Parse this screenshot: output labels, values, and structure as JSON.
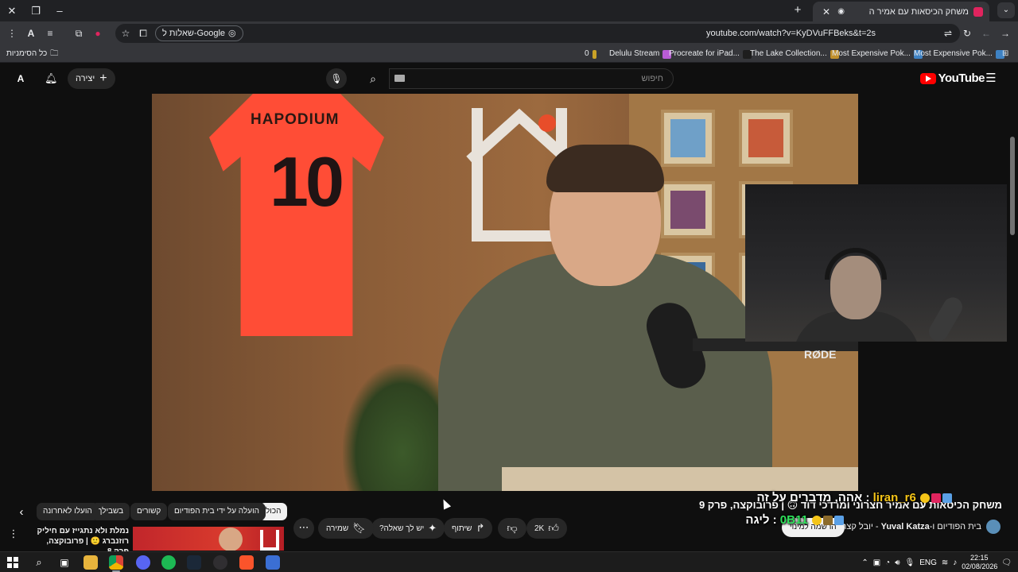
{
  "browser": {
    "tab_title": "משחק הכיסאות עם אמיר ה",
    "url": "youtube.com/watch?v=KyDVuFFBeks&t=2s",
    "google_ask_label": "שאלות ל-Google",
    "bookmarks": [
      {
        "label": "Delulu Stream",
        "color": "#b95cd6"
      },
      {
        "label": "Procreate for iPad...",
        "color": "#1e1e1e"
      },
      {
        "label": "The Lake Collection...",
        "color": "#c08f2b"
      },
      {
        "label": "Most Expensive Pok...",
        "color": "#3e82c4"
      },
      {
        "label": "Most Expensive Pok...",
        "color": "#3e82c4"
      }
    ],
    "bookmark_count": "0",
    "all_bookmarks_label": "כל הסימניות"
  },
  "youtube": {
    "logo_text": "YouTube",
    "search_placeholder": "חיפוש",
    "create_label": "יצירה",
    "avatar_letter": "A"
  },
  "video": {
    "jersey_name": "HAPODIUM",
    "jersey_number": "10",
    "mic_brand": "RØDE",
    "title": "משחק הכיסאות עם אמיר חצרוני ומרדכי דוד 🙃 | פרובוקצה, פרק 9",
    "channel_line_prefix": "בית הפודיום ו-",
    "channel_name": "Yuval Katza",
    "channel_line_suffix": " - יובל קצה",
    "ranking_label": "הרשמה למינוי"
  },
  "chat": {
    "line1_user": "liran_r6",
    "line1_msg": "אהה, מדברים על זה",
    "line2_user": "0B11",
    "line2_msg": "ליגה"
  },
  "actions": {
    "like_count": "2K",
    "share_label": "שיתוף",
    "ask_label": "יש לך שאלה?",
    "save_label": "שמירה"
  },
  "chips": {
    "all": "הכול",
    "uploaded_by": "הועלה על ידי בית הפודיום",
    "related": "קשורים",
    "for_you": "בשבילך",
    "recent": "הועלו לאחרונה"
  },
  "recommendation": {
    "title": "נמלת ולא נתגייז עם חיליק רוזנברג 🙂 | פרובוקצה, פרק 8"
  },
  "taskbar": {
    "time": "22:15",
    "date": "02/08/2026",
    "lang": "ENG",
    "notif_count": "15"
  }
}
